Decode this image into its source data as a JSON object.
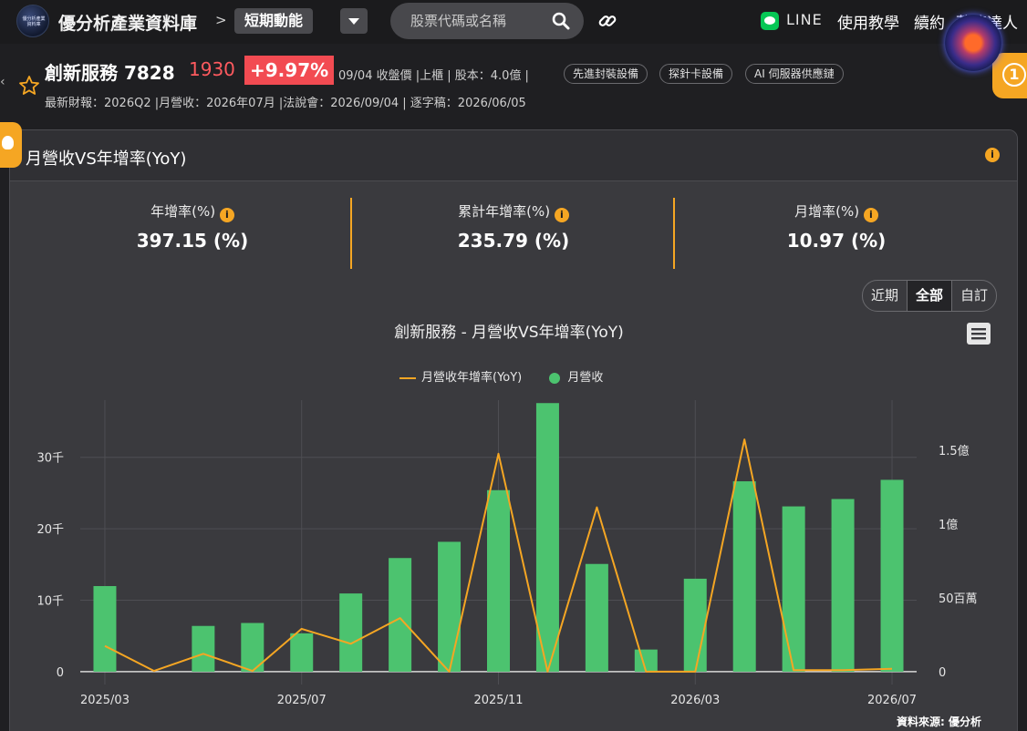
{
  "topbar": {
    "logo_text": "優分析產業資料庫",
    "brand": "優分析產業資料庫",
    "crumb_sep": ">",
    "section": "短期動能",
    "search_placeholder": "股票代碼或名稱",
    "line_label": "LINE",
    "nav": [
      "使用教學",
      "續約",
      "蘋億達人"
    ]
  },
  "float_badge": "1",
  "stock": {
    "name": "創新服務 7828",
    "price": "1930",
    "change": "+9.97%",
    "meta": "09/04 收盤價 |上櫃 | 股本：4.0億 |",
    "chips": [
      "先進封裝設備",
      "探針卡設備",
      "AI 伺服器供應鏈"
    ],
    "sub": "最新財報：2026Q2 |月營收：2026年07月 |法說會：2026/09/04 | 逐字稿：2026/06/05"
  },
  "card": {
    "title": "月營收VS年增率(YoY)",
    "info": "i",
    "stats": [
      {
        "label": "年增率(%)",
        "value": "397.15 (%)"
      },
      {
        "label": "累計年增率(%)",
        "value": "235.79 (%)"
      },
      {
        "label": "月增率(%)",
        "value": "10.97 (%)"
      }
    ],
    "ranges": [
      "近期",
      "全部",
      "自訂"
    ],
    "active_range": "全部",
    "source": "資料來源: 優分析"
  },
  "chart_data": {
    "type": "bar",
    "title": "創新服務 - 月營收VS年增率(YoY)",
    "categories": [
      "2025/03",
      "2025/04",
      "2025/05",
      "2025/06",
      "2025/07",
      "2025/08",
      "2025/09",
      "2025/10",
      "2025/11",
      "2025/12",
      "2026/01",
      "2026/02",
      "2026/03",
      "2026/04",
      "2026/05",
      "2026/06",
      "2026/07"
    ],
    "x_tick_labels": [
      "2025/03",
      "2025/07",
      "2025/11",
      "2026/03",
      "2026/07"
    ],
    "series": [
      {
        "name": "月營收",
        "type": "bar",
        "axis": "right",
        "color": "#4cc36f",
        "values": [
          58,
          0,
          31,
          33,
          26,
          53,
          77,
          88,
          123,
          182,
          73,
          15,
          63,
          129,
          112,
          117,
          130
        ]
      },
      {
        "name": "月營收年增率(YoY)",
        "type": "line",
        "axis": "left",
        "color": "#f5a623",
        "values": [
          3.6,
          0.1,
          2.5,
          0.1,
          6.0,
          3.9,
          7.5,
          0.0,
          30.5,
          0.0,
          23.0,
          0.0,
          0.0,
          32.5,
          0.2,
          0.2,
          0.4
        ]
      }
    ],
    "left_axis": {
      "ticks": [
        0,
        10,
        20,
        30
      ],
      "tick_labels": [
        "0",
        "10千",
        "20千",
        "30千"
      ],
      "range": [
        -1.8,
        38
      ]
    },
    "right_axis": {
      "tick_labels": [
        "0",
        "50百萬",
        "1億",
        "1.5億"
      ],
      "tick_values": [
        0,
        50,
        100,
        150
      ],
      "range": [
        -8.7,
        184
      ]
    },
    "grid": true,
    "legend": "top-center"
  }
}
